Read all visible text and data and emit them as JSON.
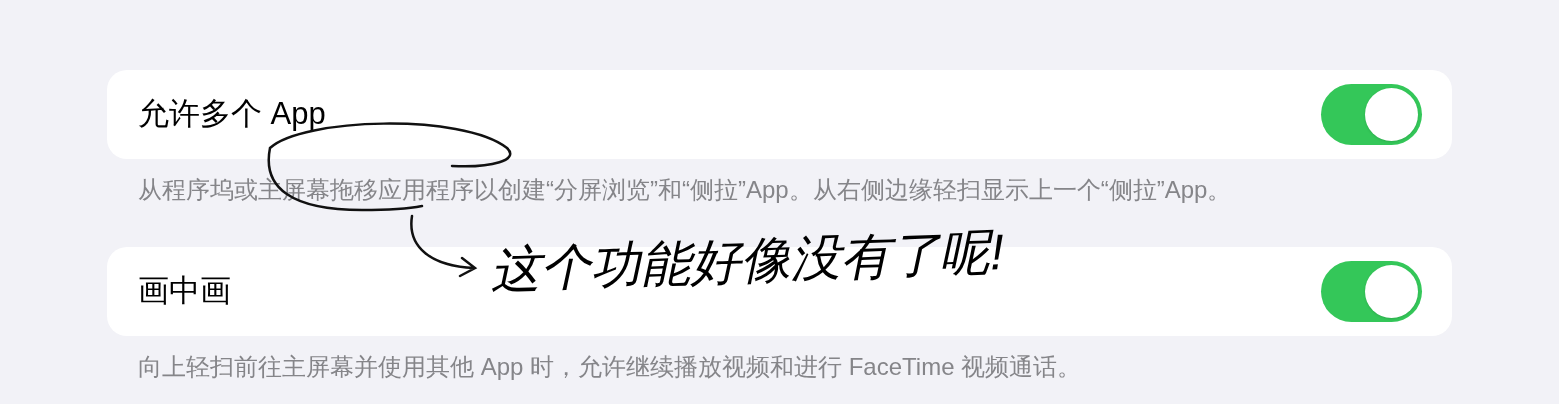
{
  "settings": [
    {
      "label": "允许多个 App",
      "on": true,
      "description": "从程序坞或主屏幕拖移应用程序以创建“分屏浏览”和“侧拉”App。从右侧边缘轻扫显示上一个“侧拉”App。"
    },
    {
      "label": "画中画",
      "on": true,
      "description": "向上轻扫前往主屏幕并使用其他 App 时，允许继续播放视频和进行 FaceTime 视频通话。"
    }
  ],
  "annotation": {
    "text": "这个功能好像没有了呢!"
  }
}
